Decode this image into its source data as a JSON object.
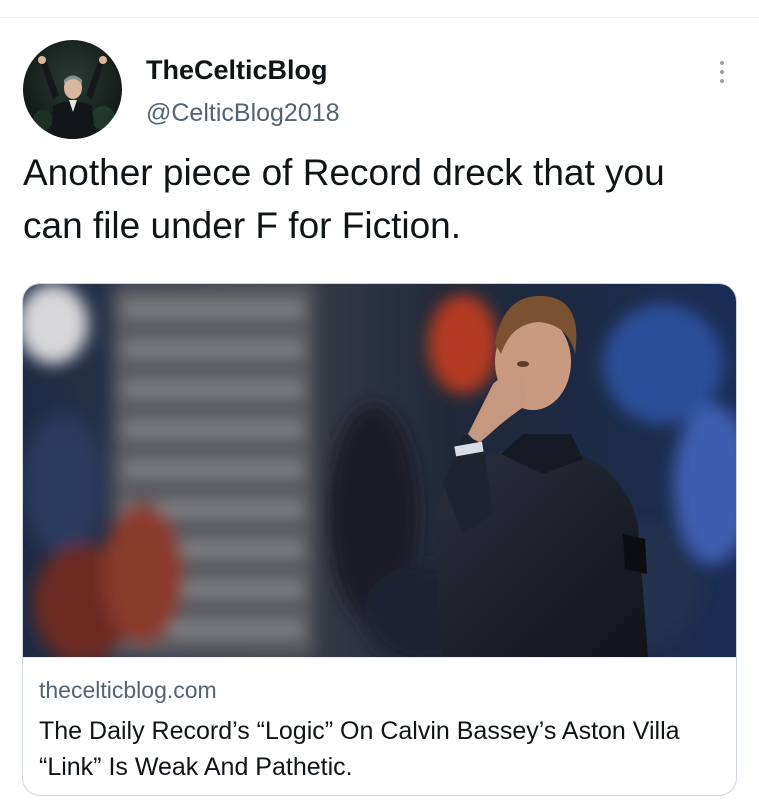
{
  "author": {
    "display_name": "TheCelticBlog",
    "handle": "@CelticBlog2018",
    "avatar_icon": "profile-photo"
  },
  "tweet": {
    "text": "Another piece of Record dreck that you can file under F for Fiction."
  },
  "more_icon": "more-options-icon",
  "card": {
    "image_icon": "article-photo",
    "domain": "theceltic blog.com",
    "title": "The Daily Record’s “Logic” On Calvin Bassey’s Aston Villa “Link” Is Weak And Pathetic."
  },
  "colors": {
    "text_primary": "#0f1419",
    "text_secondary": "#536471",
    "border": "#cfd9de"
  }
}
